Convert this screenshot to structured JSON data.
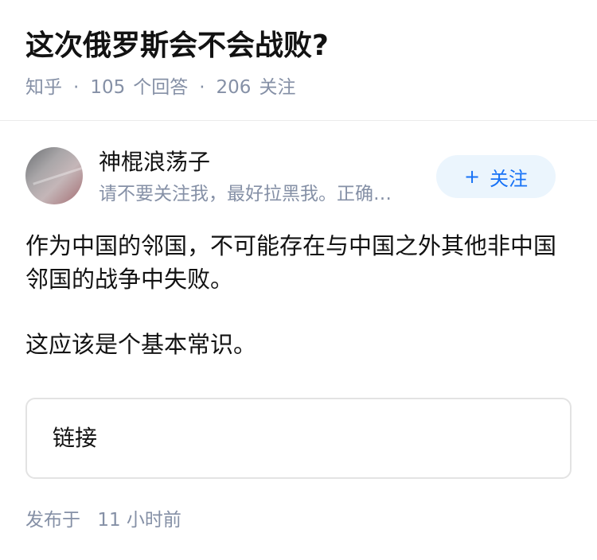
{
  "question": {
    "title": "这次俄罗斯会不会战败?",
    "source": "知乎",
    "separator": "·",
    "answer_count": "105",
    "answer_label": "个回答",
    "follower_count": "206",
    "follower_label": "关注"
  },
  "author": {
    "name": "神棍浪荡子",
    "headline": "请不要关注我，最好拉黑我。正确…",
    "follow_icon": "+",
    "follow_label": "关注"
  },
  "answer": {
    "paragraphs": [
      "作为中国的邻国，不可能存在与中国之外其他非中国邻国的战争中失败。",
      "这应该是个基本常识。"
    ],
    "link_label": "链接"
  },
  "footer": {
    "published_prefix": "发布于",
    "published_time": "11 小时前"
  },
  "colors": {
    "title": "#121212",
    "meta": "#8590a6",
    "follow_bg": "#ebf5fd",
    "follow_text": "#1772f6",
    "card_border": "#e3e3e3"
  },
  "icons": {
    "follow": "plus-icon"
  }
}
